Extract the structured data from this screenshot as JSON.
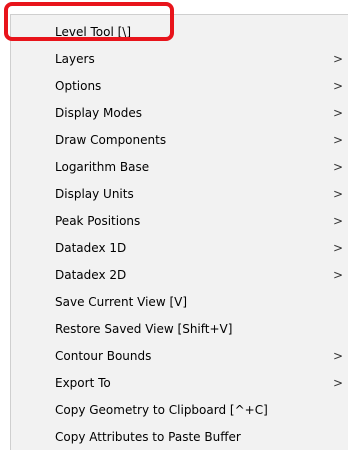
{
  "menu": {
    "items": [
      {
        "label": "Level Tool [\\]",
        "submenu": false
      },
      {
        "label": "Layers",
        "submenu": true
      },
      {
        "label": "Options",
        "submenu": true
      },
      {
        "label": "Display Modes",
        "submenu": true
      },
      {
        "label": "Draw Components",
        "submenu": true
      },
      {
        "label": "Logarithm Base",
        "submenu": true
      },
      {
        "label": "Display Units",
        "submenu": true
      },
      {
        "label": "Peak Positions",
        "submenu": true
      },
      {
        "label": "Datadex 1D",
        "submenu": true
      },
      {
        "label": "Datadex 2D",
        "submenu": true
      },
      {
        "label": "Save Current View [V]",
        "submenu": false
      },
      {
        "label": "Restore Saved View [Shift+V]",
        "submenu": false
      },
      {
        "label": "Contour Bounds",
        "submenu": true
      },
      {
        "label": "Export To",
        "submenu": true
      },
      {
        "label": "Copy Geometry to Clipboard [^+C]",
        "submenu": false
      },
      {
        "label": "Copy Attributes to Paste Buffer",
        "submenu": false
      }
    ],
    "arrow_glyph": ">"
  },
  "annotation": {
    "color": "#e8141b"
  }
}
